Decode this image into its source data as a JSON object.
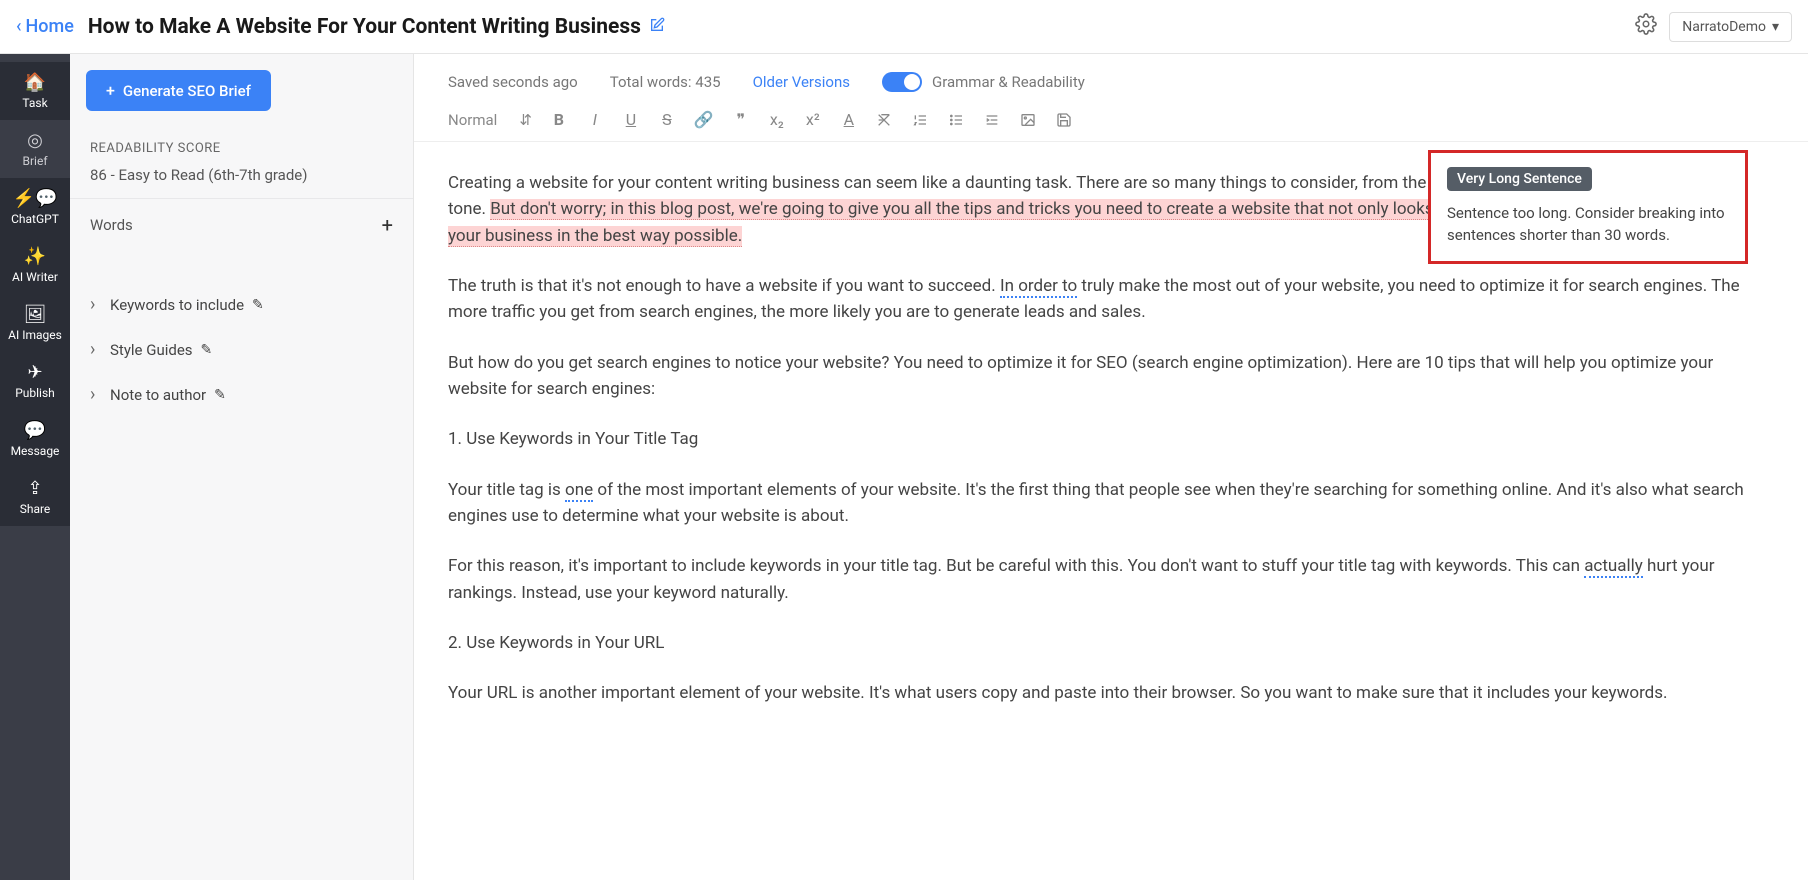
{
  "header": {
    "home": "Home",
    "title": "How to Make A Website For Your Content Writing Business",
    "account": "NarratoDemo"
  },
  "nav": {
    "task": "Task",
    "brief": "Brief",
    "chatgpt": "ChatGPT",
    "writer": "AI Writer",
    "images": "AI Images",
    "publish": "Publish",
    "message": "Message",
    "share": "Share"
  },
  "left": {
    "seo_btn": "Generate SEO Brief",
    "readability_label": "READABILITY SCORE",
    "readability_value": "86 - Easy to Read (6th-7th grade)",
    "words_label": "Words",
    "items": {
      "keywords": "Keywords to include",
      "style": "Style Guides",
      "note": "Note to author"
    }
  },
  "meta": {
    "saved": "Saved seconds ago",
    "total_words": "Total words: 435",
    "older": "Older Versions",
    "grammar": "Grammar & Readability"
  },
  "toolbar": {
    "format": "Normal"
  },
  "tip": {
    "badge": "Very Long Sentence",
    "text": "Sentence too long. Consider breaking into sentences shorter than 30 words."
  },
  "body": {
    "p1a": "Creating a website for your content writing business can seem like a daunting task. There are so many things to consider, from the design and structure to the navigation and tone. ",
    "p1b": "But don't worry; in this blog post, we're going to give you all the tips and tricks you need to create a website that not only looks professional, but also represents you and your business in the best way possible.",
    "p2a": "The truth is that it's not enough to have a website if you want to succeed. ",
    "p2b": "In order to",
    "p2c": " truly make the most out of your website, you need to optimize it for search engines. The more traffic you get from search engines, the more likely you are to generate leads and sales.",
    "p3": "But how do you get search engines to notice your website? You need to optimize it for SEO (search engine optimization). Here are 10 tips that will help you optimize your website for search engines:",
    "p4": "1. Use Keywords in Your Title Tag",
    "p5a": "Your title tag is ",
    "p5b": "one",
    "p5c": " of the most important elements of your website. It's the first thing that people see when they're searching for something online. And it's also what search engines use to determine what your website is about.",
    "p6a": "For this reason, it's important to include keywords in your title tag. But be careful with this. You don't want to stuff your title tag with keywords. This can ",
    "p6b": "actually",
    "p6c": " hurt your rankings. Instead, use your keyword naturally.",
    "p7": "2. Use Keywords in Your URL",
    "p8": "Your URL is another important element of your website. It's what users copy and paste into their browser. So you want to make sure that it includes your keywords."
  }
}
